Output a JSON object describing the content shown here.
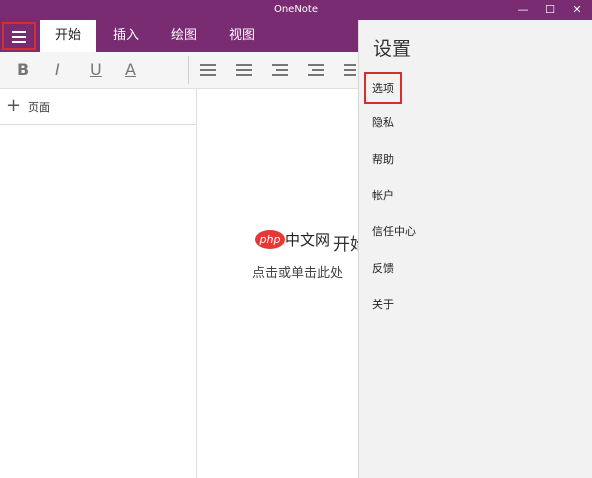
{
  "window": {
    "title": "OneNote",
    "minimize": "—",
    "maximize": "☐",
    "close": "✕"
  },
  "tabs": [
    {
      "label": "开始",
      "active": true
    },
    {
      "label": "插入"
    },
    {
      "label": "绘图"
    },
    {
      "label": "视图"
    }
  ],
  "ribbon": {
    "bold": "B",
    "italic": "I",
    "underline": "U",
    "font_color": "A"
  },
  "sidebar": {
    "add_page": "页面"
  },
  "canvas": {
    "watermark_php": "php",
    "watermark_text": "中文网",
    "hint_title": "开始",
    "hint_sub": "点击或单击此处"
  },
  "settings": {
    "title": "设置",
    "items": [
      "选项",
      "隐私",
      "帮助",
      "帐户",
      "信任中心",
      "反馈",
      "关于"
    ],
    "selected_index": 0
  },
  "colors": {
    "brand": "#7a2c72",
    "highlight": "#d32f2f"
  }
}
